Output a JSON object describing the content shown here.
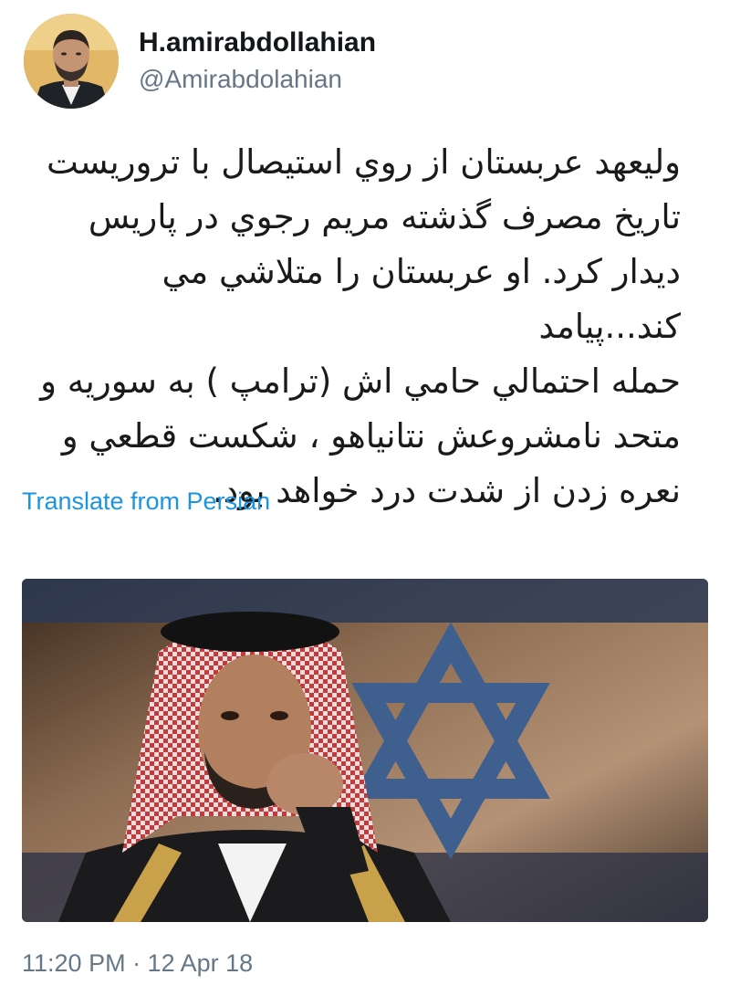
{
  "author": {
    "display_name": "H.amirabdollahian",
    "handle": "@Amirabdolahian",
    "avatar_icon": "profile-photo"
  },
  "tweet": {
    "text": "وليعهد عربستان از روي استيصال با تروريست\nتاريخ مصرف گذشته مريم رجوي در پاريس\nديدار كرد. او عربستان را متلاشي مي كند...پيامد\nحمله احتمالي حامي اش (ترامپ ) به سوريه و\nمتحد نامشروعش نتانياهو ، شكست قطعي و\nنعره زدن از شدت درد خواهد بود.",
    "translate_label": "Translate from Persian",
    "timestamp": "11:20 PM · 12 Apr 18"
  },
  "colors": {
    "link": "#1b95e0",
    "secondary_text": "#657786",
    "primary_text": "#14171a"
  }
}
